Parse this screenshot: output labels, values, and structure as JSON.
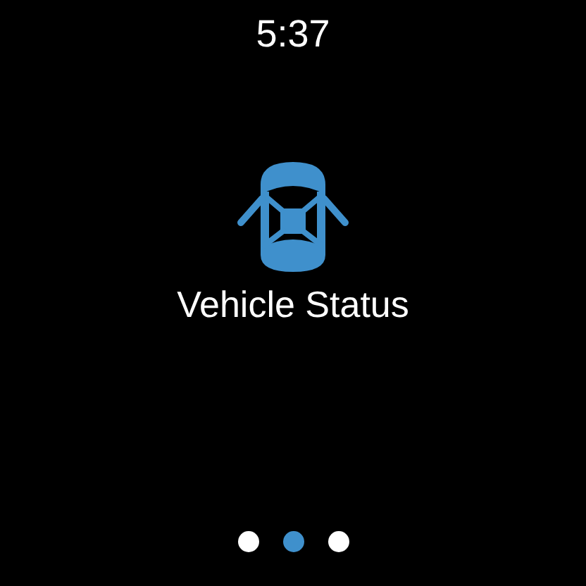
{
  "status_bar": {
    "time": "5:37"
  },
  "tile": {
    "title": "Vehicle Status"
  },
  "pager": [
    {
      "selected": false
    },
    {
      "selected": true
    },
    {
      "selected": false
    }
  ]
}
